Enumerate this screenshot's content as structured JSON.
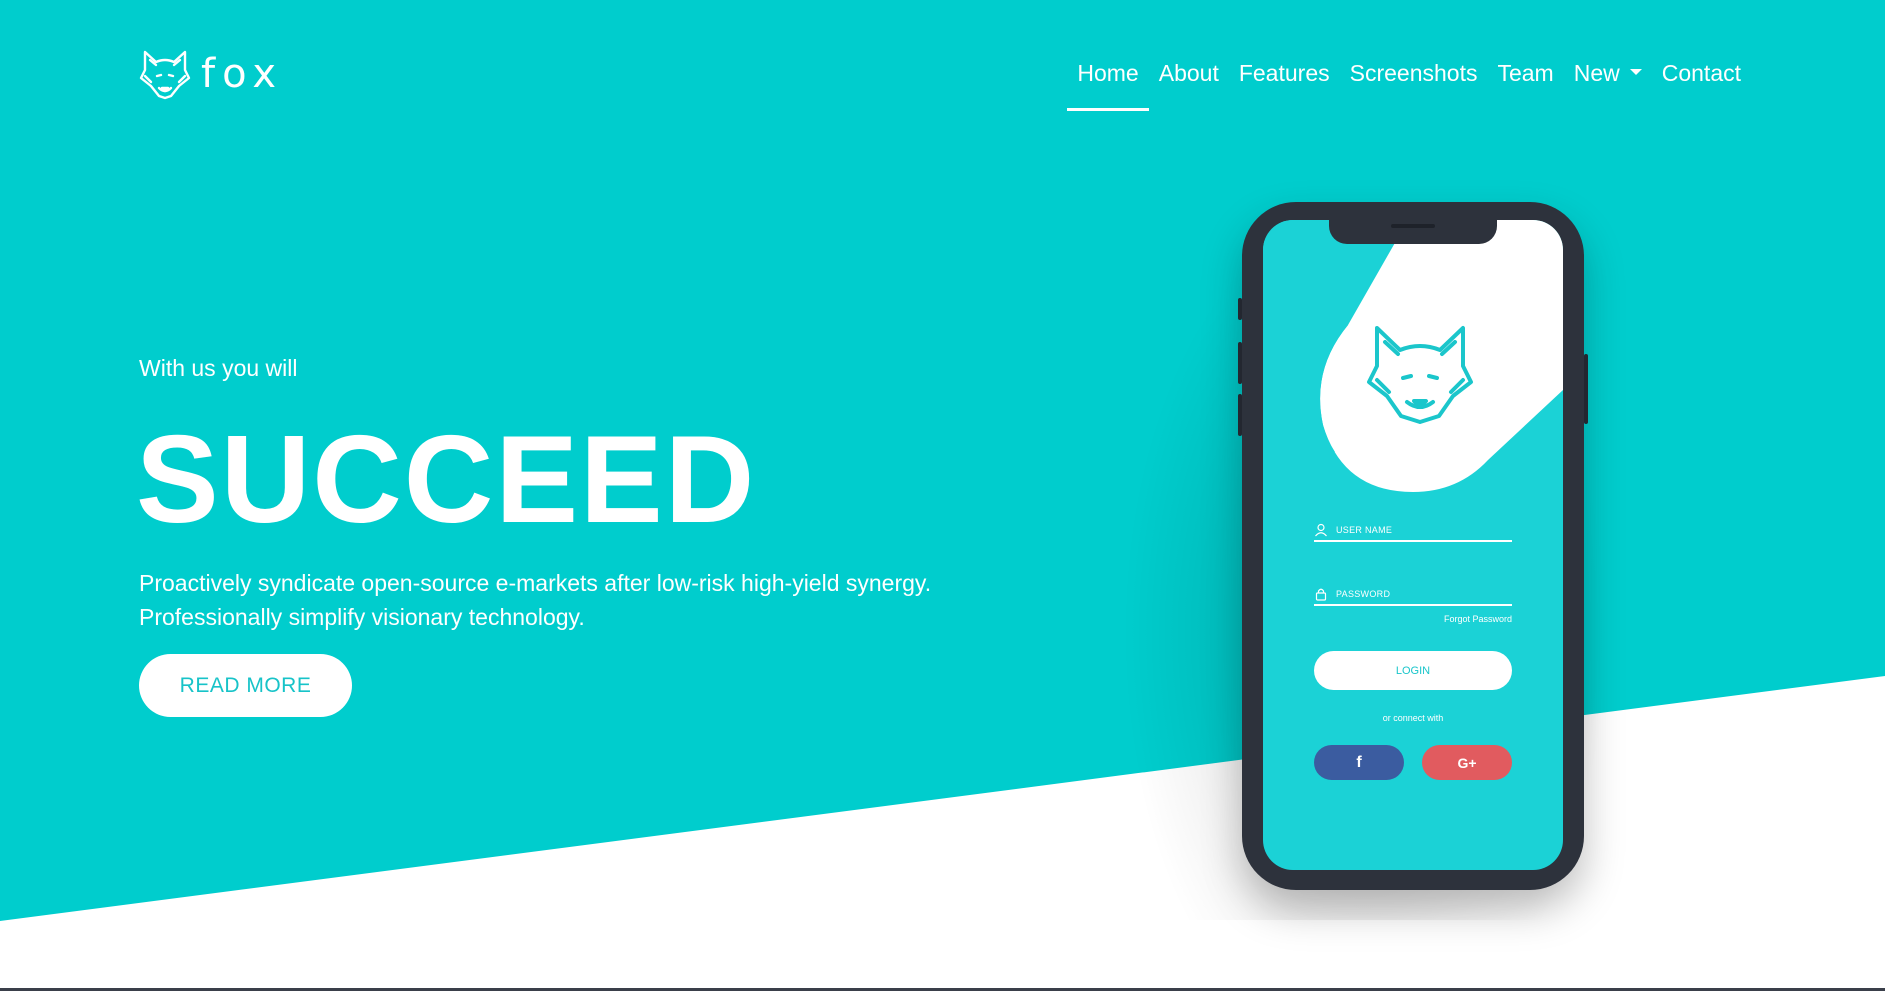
{
  "brand": {
    "name": "fox",
    "icon": "fox-head-icon"
  },
  "nav": {
    "items": [
      {
        "label": "Home",
        "active": true
      },
      {
        "label": "About"
      },
      {
        "label": "Features"
      },
      {
        "label": "Screenshots"
      },
      {
        "label": "Team"
      },
      {
        "label": "New",
        "dropdown": true
      },
      {
        "label": "Contact"
      }
    ]
  },
  "hero": {
    "tagline": "With us you will",
    "headline": "SUCCEED",
    "description_line1": "Proactively syndicate open-source e-markets after low-risk high-yield synergy.",
    "description_line2": "Professionally simplify visionary technology.",
    "cta_label": "READ MORE"
  },
  "phone_app": {
    "username_label": "USER NAME",
    "password_label": "PASSWORD",
    "forgot_label": "Forgot Password",
    "login_label": "LOGIN",
    "connect_label": "or connect with",
    "facebook_label": "f",
    "google_label": "G+"
  },
  "colors": {
    "primary": "#00cdcd",
    "screen": "#1bd2d6",
    "phone_body": "#2d323c",
    "facebook": "#3b5ca0",
    "google": "#e15b5f"
  }
}
